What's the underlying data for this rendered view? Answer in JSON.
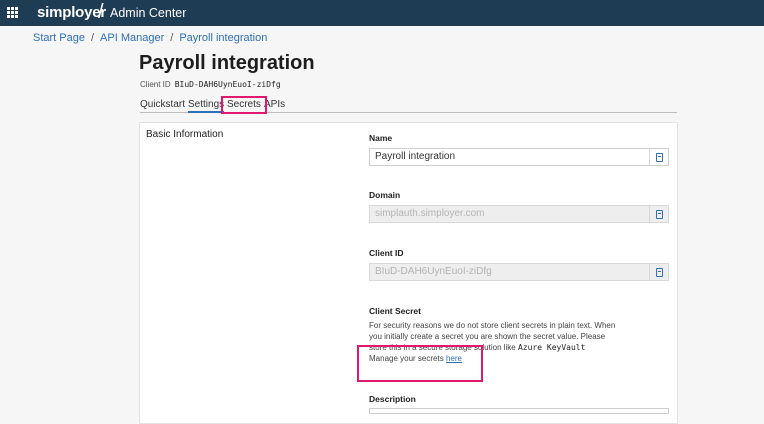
{
  "app": {
    "brand": "simployer",
    "title": "Admin Center"
  },
  "breadcrumb": {
    "items": [
      "Start Page",
      "API Manager",
      "Payroll integration"
    ]
  },
  "page": {
    "title": "Payroll integration",
    "client_id_label": "Client ID",
    "client_id_value": "BIuD-DAH6UynEuoI-ziDfg"
  },
  "tabs": [
    {
      "label": "Quickstart",
      "active": false
    },
    {
      "label": "Settings",
      "active": true
    },
    {
      "label": "Secrets",
      "active": false
    },
    {
      "label": "APIs",
      "active": false
    }
  ],
  "basic_info": {
    "heading": "Basic Information",
    "name_label": "Name",
    "name_value": "Payroll integration",
    "domain_label": "Domain",
    "domain_value": "simplauth.simployer.com",
    "client_id_label": "Client ID",
    "client_id_value": "BIuD-DAH6UynEuoI-ziDfg",
    "client_secret_label": "Client Secret",
    "client_secret_text_1": "For security reasons we do not store client secrets in plain text. When you initially create a secret you are shown the secret value. Please store this in a secure storage solution like",
    "client_secret_mono": "Azure KeyVault",
    "manage_text": "Manage your secrets",
    "manage_link": "here",
    "description_label": "Description"
  },
  "colors": {
    "topbar": "#1f3c55",
    "link": "#2d70b7",
    "highlight": "#e0196f"
  }
}
